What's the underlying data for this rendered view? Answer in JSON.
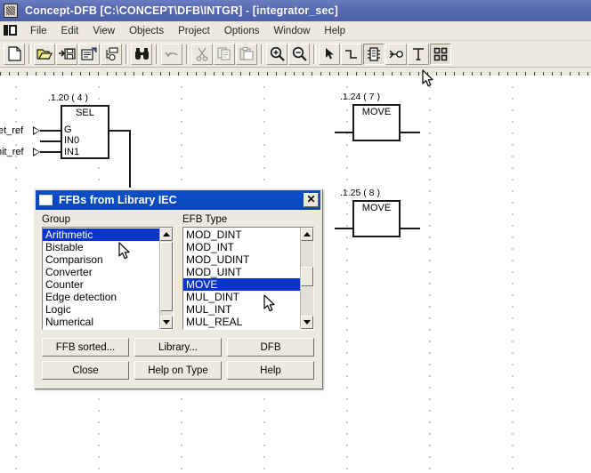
{
  "window": {
    "title": "Concept-DFB [C:\\CONCEPT\\DFB\\INTGR]  - [integrator_sec]",
    "app_icon": "application-icon",
    "titlebar_color": "#5568b0"
  },
  "menubar": {
    "system_icon": "mdi-restore-icon",
    "items": [
      {
        "label": "File"
      },
      {
        "label": "Edit"
      },
      {
        "label": "View"
      },
      {
        "label": "Objects"
      },
      {
        "label": "Project"
      },
      {
        "label": "Options"
      },
      {
        "label": "Window"
      },
      {
        "label": "Help"
      }
    ]
  },
  "toolbar": {
    "buttons": [
      {
        "name": "new-file-icon",
        "tip": "New"
      },
      {
        "name": "open-folder-icon",
        "tip": "Open"
      },
      {
        "name": "save-icon",
        "tip": "Save"
      },
      {
        "name": "properties-icon",
        "tip": "Properties"
      },
      {
        "name": "project-browser-icon",
        "tip": "Project browser"
      },
      {
        "name": "binoculars-search-icon",
        "tip": "Search"
      },
      {
        "name": "undo-icon",
        "tip": "Undo"
      },
      {
        "name": "cut-scissors-icon",
        "tip": "Cut"
      },
      {
        "name": "copy-icon",
        "tip": "Copy"
      },
      {
        "name": "paste-icon",
        "tip": "Paste"
      },
      {
        "name": "zoom-in-icon",
        "tip": "Zoom in"
      },
      {
        "name": "zoom-out-icon",
        "tip": "Zoom out"
      },
      {
        "name": "pointer-select-icon",
        "tip": "Select"
      },
      {
        "name": "link-wire-icon",
        "tip": "Link"
      },
      {
        "name": "ffb-block-icon",
        "tip": "FFB"
      },
      {
        "name": "connection-point-icon",
        "tip": "Connection"
      },
      {
        "name": "text-tool-icon",
        "tip": "Text"
      },
      {
        "name": "ffb-library-icon",
        "tip": "FFB library",
        "pressed": true
      }
    ]
  },
  "canvas": {
    "blocks": [
      {
        "id": "sel-block",
        "label": ".1.20 ( 4 )",
        "type": "SEL",
        "inputs": [
          "G",
          "IN0",
          "IN1"
        ]
      },
      {
        "id": "move-block-1",
        "label": ".1.24 ( 7 )",
        "type": "MOVE",
        "inputs": []
      },
      {
        "id": "move-block-2",
        "label": ".1.25 ( 8 )",
        "type": "MOVE",
        "inputs": []
      }
    ],
    "connectors": [
      {
        "name": "set-ref-connector",
        "label": "et_ref"
      },
      {
        "name": "init-ref-connector",
        "label": "nit_ref"
      }
    ]
  },
  "dialog": {
    "title": "FFBs from Library IEC",
    "icon": "dialog-window-icon",
    "close_label": "✕",
    "group": {
      "caption": "Group",
      "items": [
        "Arithmetic",
        "Bistable",
        "Comparison",
        "Converter",
        "Counter",
        "Edge detection",
        "Logic",
        "Numerical"
      ],
      "selected": "Arithmetic"
    },
    "efb_type": {
      "caption": "EFB Type",
      "items": [
        "MOD_DINT",
        "MOD_INT",
        "MOD_UDINT",
        "MOD_UINT",
        "MOVE",
        "MUL_DINT",
        "MUL_INT",
        "MUL_REAL"
      ],
      "selected": "MOVE"
    },
    "buttons": [
      {
        "label": "FFB sorted..."
      },
      {
        "label": "Library..."
      },
      {
        "label": "DFB"
      },
      {
        "label": "Close"
      },
      {
        "label": "Help on Type"
      },
      {
        "label": "Help"
      }
    ],
    "selection_color": "#0a35c8",
    "titlebar_color": "#0a47b6"
  },
  "cursors": [
    {
      "name": "mouse-cursor-toolbar"
    },
    {
      "name": "mouse-cursor-group-list"
    },
    {
      "name": "mouse-cursor-efb-list"
    }
  ]
}
